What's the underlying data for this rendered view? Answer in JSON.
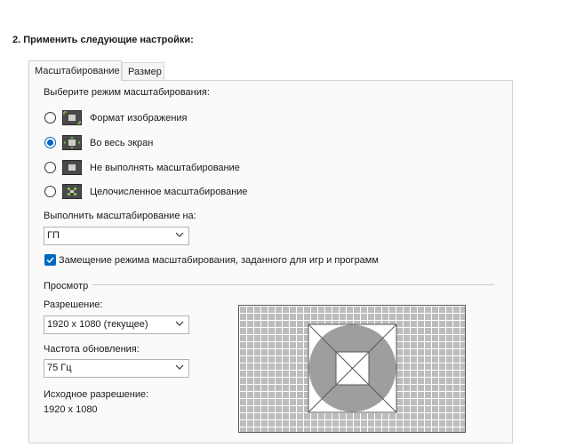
{
  "section": {
    "heading": "2. Применить следующие настройки:"
  },
  "tabs": [
    {
      "label": "Масштабирование",
      "active": true
    },
    {
      "label": "Размер",
      "active": false
    }
  ],
  "scaling": {
    "prompt": "Выберите режим масштабирования:",
    "options": [
      {
        "label": "Формат изображения",
        "selected": false,
        "icon": "aspect-ratio-icon"
      },
      {
        "label": "Во весь экран",
        "selected": true,
        "icon": "full-screen-icon"
      },
      {
        "label": "Не выполнять масштабирование",
        "selected": false,
        "icon": "no-scaling-icon"
      },
      {
        "label": "Целочисленное масштабирование",
        "selected": false,
        "icon": "integer-scaling-icon"
      }
    ],
    "perform_on_label": "Выполнить масштабирование на:",
    "perform_on_value": "ГП",
    "override_label": "Замещение режима масштабирования, заданного для игр и программ",
    "override_checked": true
  },
  "preview": {
    "group_label": "Просмотр",
    "resolution_label": "Разрешение:",
    "resolution_value": "1920 x 1080 (текущее)",
    "refresh_label": "Частота обновления:",
    "refresh_value": "75 Гц",
    "native_label": "Исходное разрешение:",
    "native_value": "1920 x 1080"
  },
  "colors": {
    "accent": "#0067c0",
    "preview_gray": "#9e9e9e",
    "preview_grid": "#bdbdbd"
  }
}
